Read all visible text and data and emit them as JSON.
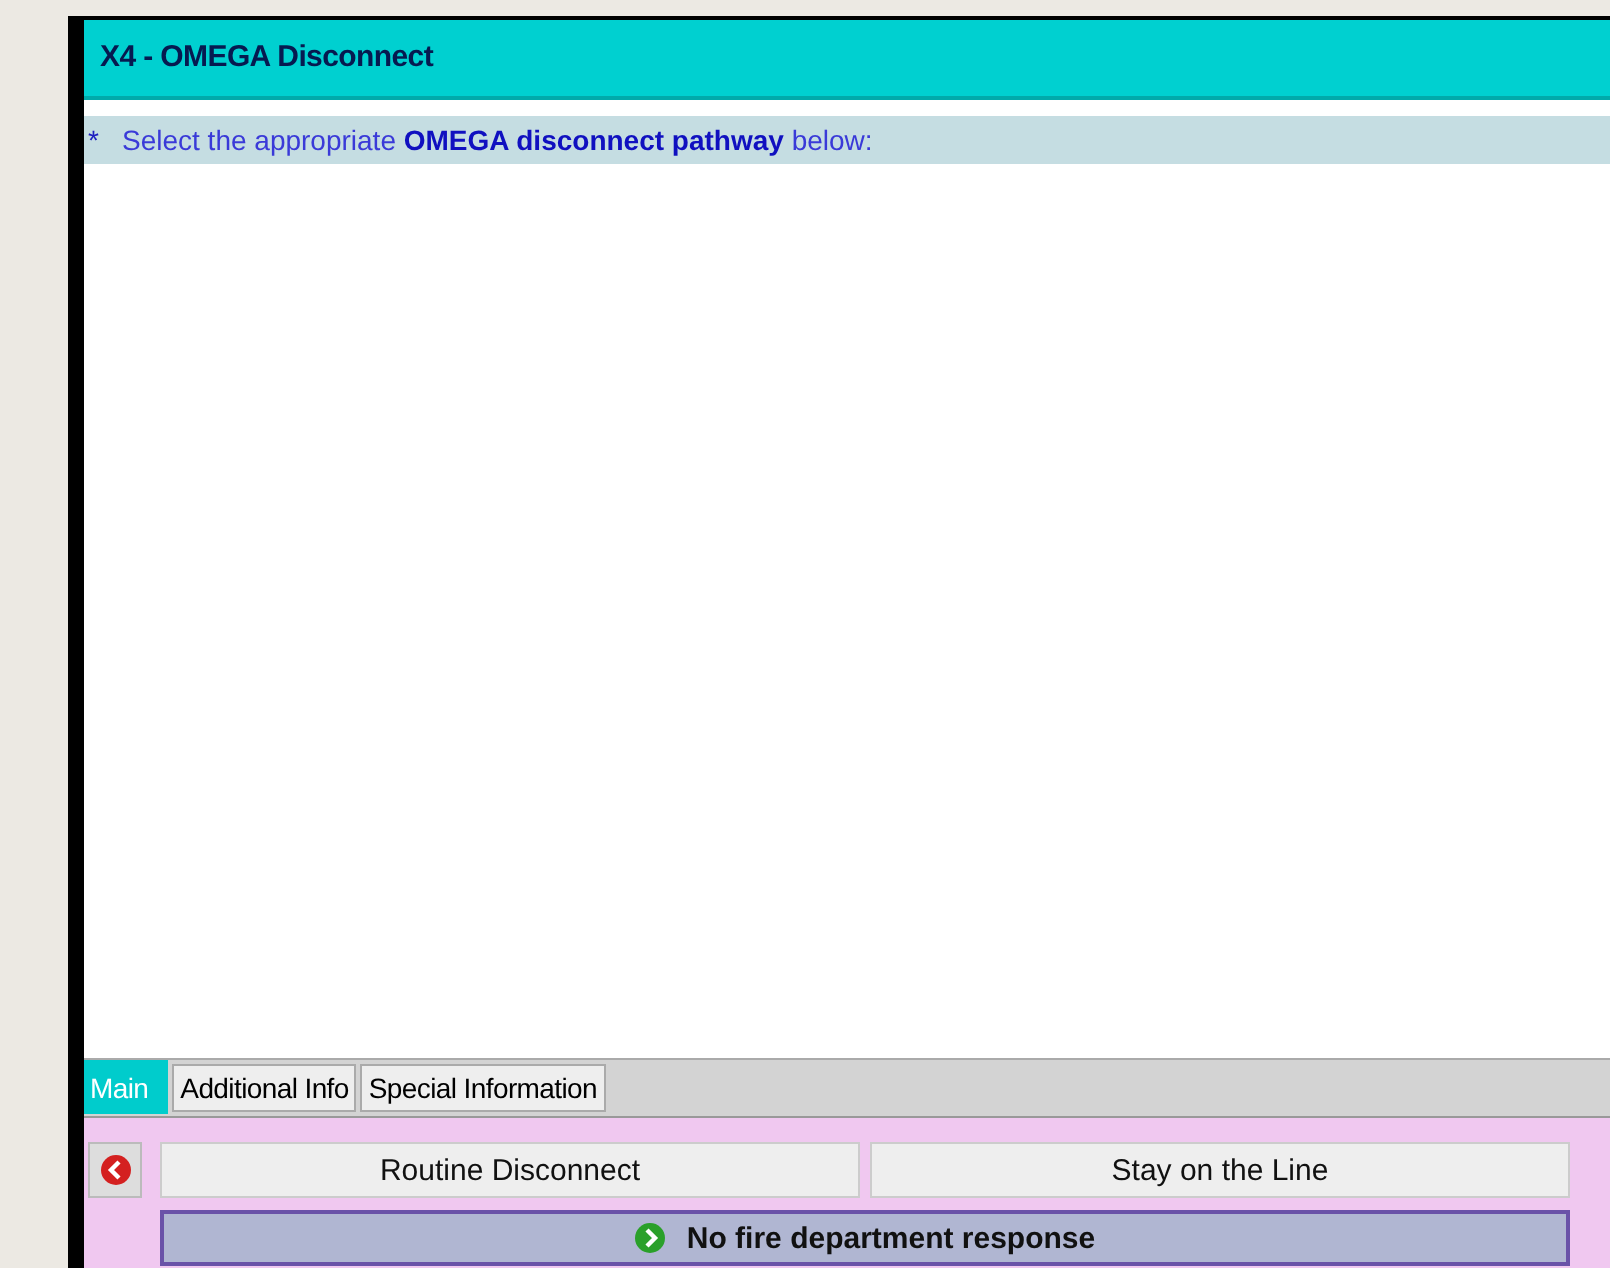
{
  "window": {
    "title": "X4 - OMEGA Disconnect"
  },
  "prompt": {
    "marker": "*",
    "text": "Select the appropriate **OMEGA disconnect pathway** below:"
  },
  "tabs": [
    {
      "label": "Main",
      "selected": true
    },
    {
      "label": "Additional Info",
      "selected": false
    },
    {
      "label": "Special Information",
      "selected": false
    }
  ],
  "buttons": [
    {
      "label": "Routine Disconnect",
      "selected": false
    },
    {
      "label": "Stay on the Line",
      "selected": false
    },
    {
      "label": "No fire department response",
      "selected": true
    }
  ]
}
